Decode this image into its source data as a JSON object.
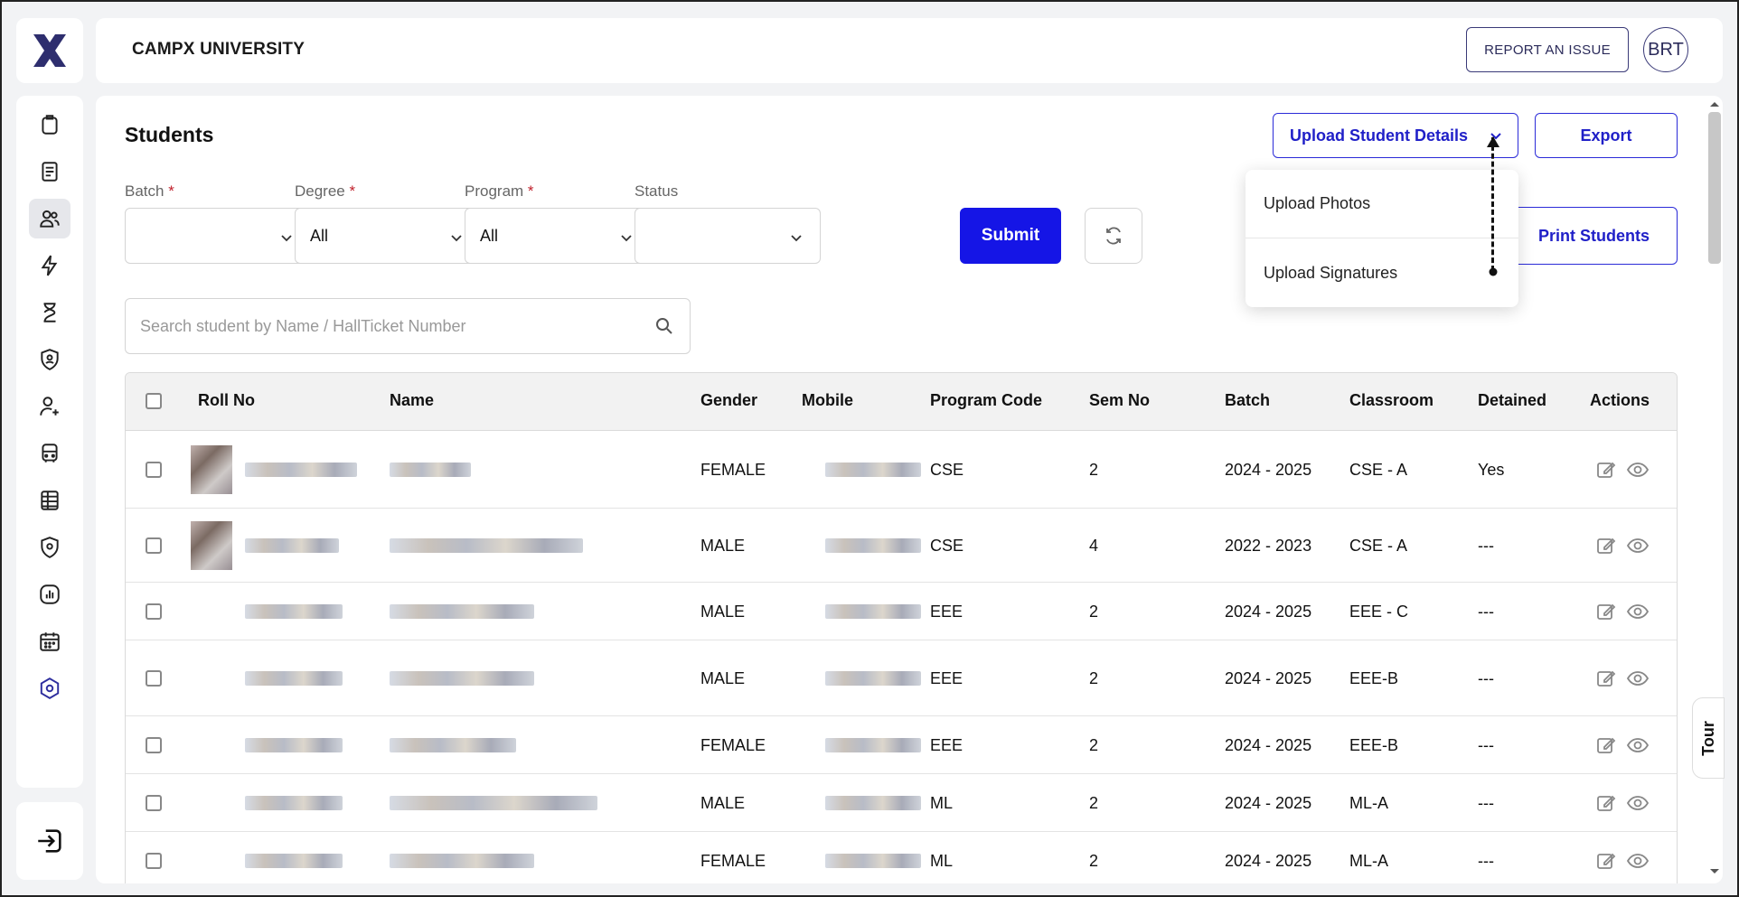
{
  "header": {
    "university": "CAMPX UNIVERSITY",
    "report_label": "REPORT AN ISSUE",
    "avatar_initials": "BRT"
  },
  "sidebar": {
    "icons": [
      "clipboard-icon",
      "document-icon",
      "users-icon",
      "bolt-icon",
      "hourglass-icon",
      "shield-user-icon",
      "user-plus-icon",
      "bus-icon",
      "spreadsheet-icon",
      "location-shield-icon",
      "chart-icon",
      "calendar-icon",
      "settings-icon"
    ],
    "active_index": 2,
    "logout_icon": "logout-icon"
  },
  "page": {
    "title": "Students",
    "upload_label": "Upload Student Details",
    "export_label": "Export",
    "print_label": "Print Students",
    "dropdown": [
      "Upload Photos",
      "Upload Signatures"
    ]
  },
  "filters": {
    "batch_label": "Batch",
    "batch_value": "",
    "degree_label": "Degree",
    "degree_value": "All",
    "program_label": "Program",
    "program_value": "All",
    "status_label": "Status",
    "status_value": "",
    "required_mark": "*",
    "submit_label": "Submit"
  },
  "search": {
    "placeholder": "Search student by Name / HallTicket Number"
  },
  "table": {
    "headers": [
      "Roll No",
      "Name",
      "Gender",
      "Mobile",
      "Program Code",
      "Sem No",
      "Batch",
      "Classroom",
      "Detained",
      "Actions"
    ],
    "rows": [
      {
        "gender": "FEMALE",
        "program_code": "CSE",
        "sem": "2",
        "batch": "2024 - 2025",
        "classroom": "CSE - A",
        "detained": "Yes"
      },
      {
        "gender": "MALE",
        "program_code": "CSE",
        "sem": "4",
        "batch": "2022 - 2023",
        "classroom": "CSE - A",
        "detained": "---"
      },
      {
        "gender": "MALE",
        "program_code": "EEE",
        "sem": "2",
        "batch": "2024 - 2025",
        "classroom": "EEE - C",
        "detained": "---"
      },
      {
        "gender": "MALE",
        "program_code": "EEE",
        "sem": "2",
        "batch": "2024 - 2025",
        "classroom": "EEE-B",
        "detained": "---"
      },
      {
        "gender": "FEMALE",
        "program_code": "EEE",
        "sem": "2",
        "batch": "2024 - 2025",
        "classroom": "EEE-B",
        "detained": "---"
      },
      {
        "gender": "MALE",
        "program_code": "ML",
        "sem": "2",
        "batch": "2024 - 2025",
        "classroom": "ML-A",
        "detained": "---"
      },
      {
        "gender": "FEMALE",
        "program_code": "ML",
        "sem": "2",
        "batch": "2024 - 2025",
        "classroom": "ML-A",
        "detained": "---"
      }
    ]
  },
  "tour_label": "Tour",
  "colors": {
    "accent": "#1515e6",
    "navy": "#2b2b5a",
    "logo": "#2e2e6e"
  }
}
